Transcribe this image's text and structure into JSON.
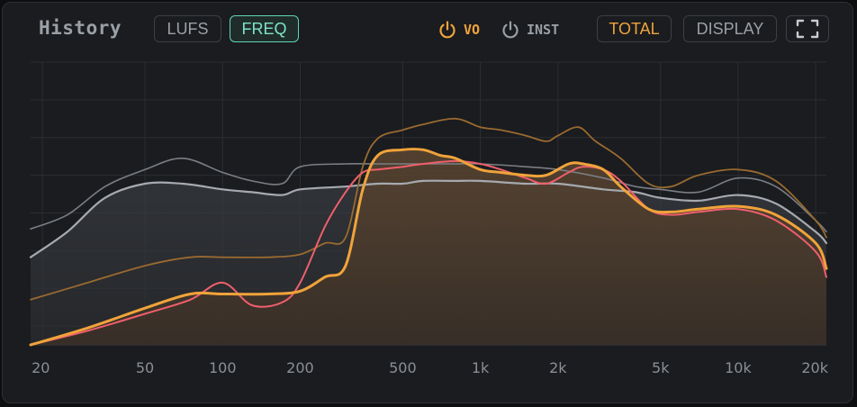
{
  "header": {
    "title": "History",
    "mode_buttons": [
      {
        "label": "LUFS",
        "active": false
      },
      {
        "label": "FREQ",
        "active": true
      }
    ],
    "toggles": [
      {
        "label": "VO",
        "on": true,
        "color": "#f0a33a"
      },
      {
        "label": "INST",
        "on": false,
        "color": "#9aa0a6"
      }
    ],
    "total_label": "TOTAL",
    "display_label": "DISPLAY",
    "expand_icon": "expand-icon"
  },
  "colors": {
    "accent_green": "#5fd6b5",
    "accent_orange": "#f0a33a",
    "total_curve": "#f0a33a",
    "vo_curve": "#ef5f6c",
    "inst_curve": "#a6aab0",
    "inst_peak_curve": "#7a7e84",
    "total_peak_curve": "#9a6a30"
  },
  "chart_data": {
    "type": "area",
    "x_scale": "log",
    "xlim": [
      18,
      22000
    ],
    "ylim": [
      0,
      100
    ],
    "x_ticks": [
      {
        "value": 20,
        "label": "20"
      },
      {
        "value": 50,
        "label": "50"
      },
      {
        "value": 100,
        "label": "100"
      },
      {
        "value": 200,
        "label": "200"
      },
      {
        "value": 500,
        "label": "500"
      },
      {
        "value": 1000,
        "label": "1k"
      },
      {
        "value": 2000,
        "label": "2k"
      },
      {
        "value": 5000,
        "label": "5k"
      },
      {
        "value": 10000,
        "label": "10k"
      },
      {
        "value": 20000,
        "label": "20k"
      }
    ],
    "grid": true,
    "series": [
      {
        "id": "inst-fill-curve",
        "x": [
          18,
          25,
          35,
          50,
          70,
          100,
          130,
          170,
          200,
          300,
          400,
          500,
          600,
          800,
          1000,
          1500,
          2000,
          3000,
          4000,
          5000,
          7000,
          10000,
          14000,
          20000,
          22000
        ],
        "y": [
          31,
          40,
          52,
          57,
          57,
          55,
          54,
          53,
          55,
          56,
          57,
          57,
          58,
          58,
          58,
          57,
          57,
          55,
          54,
          52,
          51,
          53,
          50,
          40,
          36
        ]
      },
      {
        "id": "inst-peak-curve",
        "x": [
          18,
          25,
          35,
          50,
          70,
          100,
          130,
          170,
          200,
          300,
          400,
          500,
          600,
          800,
          1000,
          1500,
          2000,
          3000,
          4000,
          5000,
          7000,
          10000,
          14000,
          20000,
          22000
        ],
        "y": [
          41,
          46,
          56,
          62,
          66,
          61,
          58,
          57,
          63,
          64,
          64,
          64,
          64,
          64,
          64,
          63,
          62,
          59,
          56,
          55,
          54,
          59,
          56,
          44,
          40
        ]
      },
      {
        "id": "total-curve",
        "x": [
          18,
          30,
          50,
          75,
          100,
          150,
          200,
          250,
          300,
          350,
          400,
          500,
          600,
          700,
          800,
          1000,
          1200,
          1500,
          1800,
          2200,
          2500,
          3000,
          3500,
          4500,
          5500,
          7000,
          10000,
          14000,
          20000,
          22000
        ],
        "y": [
          0,
          6,
          13,
          18,
          18,
          18,
          19,
          24,
          28,
          55,
          67,
          69,
          69,
          67,
          66,
          62,
          61,
          60,
          60,
          64,
          64,
          62,
          56,
          48,
          47,
          48,
          49,
          46,
          36,
          27
        ]
      },
      {
        "id": "vo-curve",
        "x": [
          18,
          30,
          50,
          75,
          100,
          130,
          170,
          200,
          250,
          300,
          350,
          400,
          500,
          600,
          800,
          1000,
          1200,
          1500,
          1800,
          2200,
          2500,
          3000,
          3500,
          4500,
          5500,
          7000,
          10000,
          14000,
          20000,
          22000
        ],
        "y": [
          0,
          5,
          11,
          16,
          22,
          14,
          15,
          22,
          42,
          54,
          61,
          62,
          63,
          64,
          65,
          64,
          62,
          59,
          57,
          61,
          63,
          62,
          58,
          48,
          46,
          47,
          48,
          44,
          33,
          24
        ]
      },
      {
        "id": "total-peak-curve",
        "x": [
          18,
          30,
          50,
          75,
          100,
          150,
          200,
          250,
          300,
          350,
          400,
          500,
          600,
          800,
          1000,
          1200,
          1500,
          1800,
          2000,
          2400,
          2800,
          3500,
          4500,
          5500,
          7000,
          10000,
          14000,
          20000,
          22000
        ],
        "y": [
          16,
          22,
          28,
          31,
          31,
          31,
          32,
          36,
          38,
          63,
          73,
          76,
          78,
          80,
          77,
          76,
          74,
          72,
          74,
          77,
          72,
          66,
          57,
          56,
          60,
          62,
          58,
          44,
          38
        ]
      }
    ]
  }
}
